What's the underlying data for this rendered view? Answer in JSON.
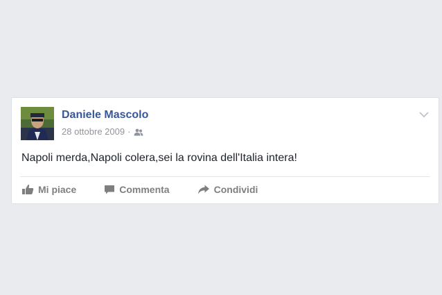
{
  "post": {
    "author": "Daniele Mascolo",
    "date": "28 ottobre 2009",
    "separator": "·",
    "audience_icon": "friends-icon",
    "text": "Napoli merda,Napoli colera,sei la rovina dell'Italia intera!",
    "menu_icon": "chevron-down-icon"
  },
  "actions": {
    "like": {
      "label": "Mi piace",
      "icon": "thumbs-up-icon"
    },
    "comment": {
      "label": "Commenta",
      "icon": "comment-icon"
    },
    "share": {
      "label": "Condividi",
      "icon": "share-arrow-icon"
    }
  },
  "colors": {
    "background": "#e9ebee",
    "author_link": "#365899",
    "meta": "#90949c",
    "action": "#7f7f7f",
    "text": "#1d2129"
  }
}
